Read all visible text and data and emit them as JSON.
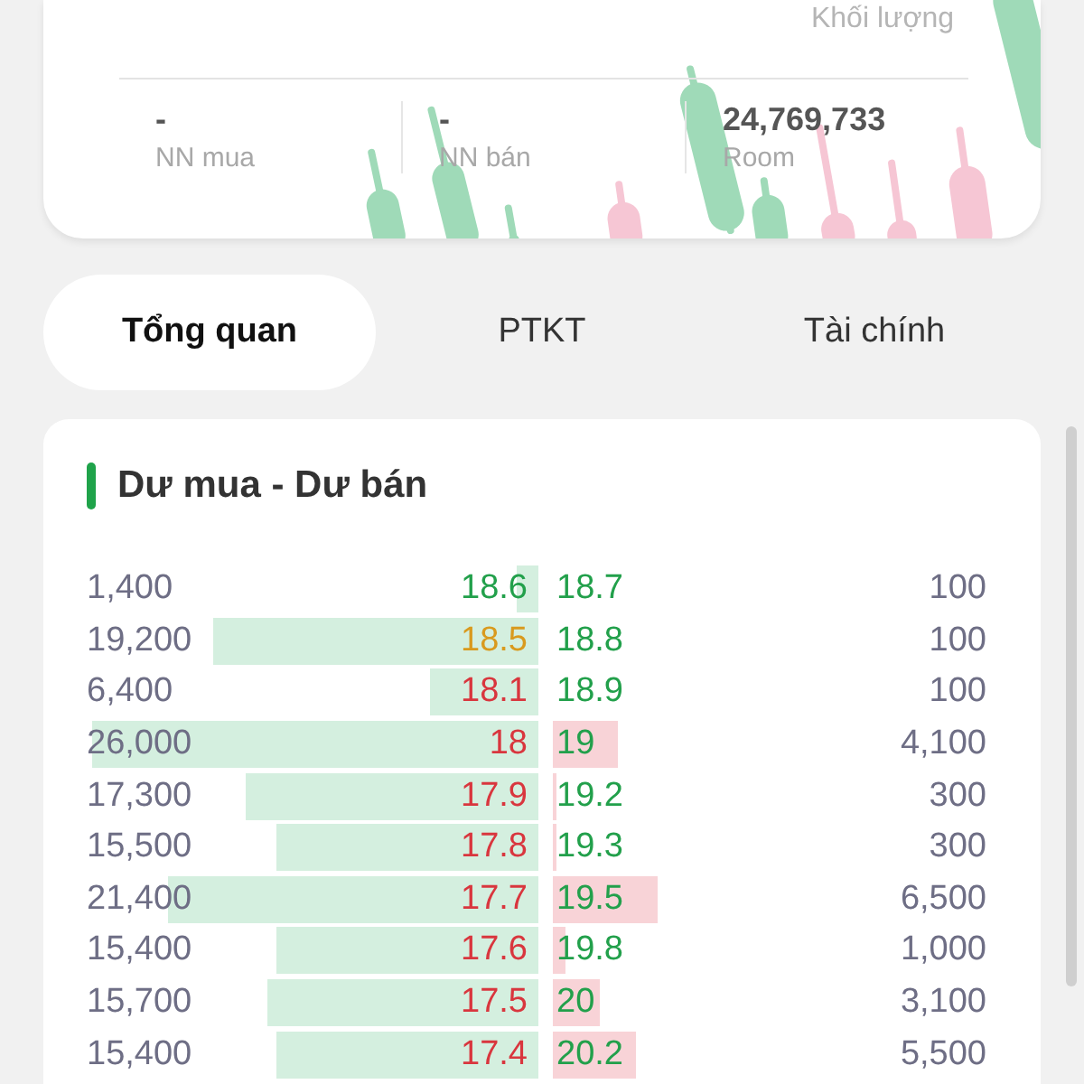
{
  "summary": {
    "volume_label": "Khối lượng",
    "stats": [
      {
        "value": "-",
        "label": "NN mua"
      },
      {
        "value": "-",
        "label": "NN bán"
      },
      {
        "value": "24,769,733",
        "label": "Room"
      }
    ]
  },
  "tabs": [
    {
      "label": "Tổng quan",
      "selected": true
    },
    {
      "label": "PTKT",
      "selected": false
    },
    {
      "label": "Tài chính",
      "selected": false
    }
  ],
  "order_book": {
    "title": "Dư mua - Dư bán",
    "rows": [
      {
        "bid": {
          "volume": "1,400",
          "level": 0.05,
          "price": "18.6",
          "kind": "up"
        },
        "ask": {
          "price": "18.7",
          "kind": "up",
          "volume": "100"
        }
      },
      {
        "bid": {
          "volume": "19,200",
          "level": 0.72,
          "price": "18.5",
          "kind": "reference"
        },
        "ask": {
          "price": "18.8",
          "kind": "up",
          "volume": "100"
        }
      },
      {
        "bid": {
          "volume": "6,400",
          "level": 0.24,
          "price": "18.1",
          "kind": "down"
        },
        "ask": {
          "price": "18.9",
          "kind": "up",
          "volume": "100"
        }
      },
      {
        "bid": {
          "volume": "26,000",
          "level": 0.99,
          "price": "18",
          "kind": "down"
        },
        "ask": {
          "price": "19",
          "kind": "up",
          "level": 0.15,
          "volume": "4,100"
        }
      },
      {
        "bid": {
          "volume": "17,300",
          "level": 0.65,
          "price": "17.9",
          "kind": "down"
        },
        "ask": {
          "price": "19.2",
          "kind": "up",
          "level": 0.01,
          "volume": "300"
        }
      },
      {
        "bid": {
          "volume": "15,500",
          "level": 0.58,
          "price": "17.8",
          "kind": "down"
        },
        "ask": {
          "price": "19.3",
          "kind": "up",
          "level": 0.01,
          "volume": "300"
        }
      },
      {
        "bid": {
          "volume": "21,400",
          "level": 0.82,
          "price": "17.7",
          "kind": "down"
        },
        "ask": {
          "price": "19.5",
          "kind": "up",
          "level": 0.24,
          "volume": "6,500"
        }
      },
      {
        "bid": {
          "volume": "15,400",
          "level": 0.58,
          "price": "17.6",
          "kind": "down"
        },
        "ask": {
          "price": "19.8",
          "kind": "up",
          "level": 0.03,
          "volume": "1,000"
        }
      },
      {
        "bid": {
          "volume": "15,700",
          "level": 0.6,
          "price": "17.5",
          "kind": "down"
        },
        "ask": {
          "price": "20",
          "kind": "up",
          "level": 0.11,
          "volume": "3,100"
        }
      },
      {
        "bid": {
          "volume": "15,400",
          "level": 0.58,
          "price": "17.4",
          "kind": "down"
        },
        "ask": {
          "price": "20.2",
          "kind": "up",
          "level": 0.19,
          "volume": "5,500"
        }
      }
    ]
  }
}
